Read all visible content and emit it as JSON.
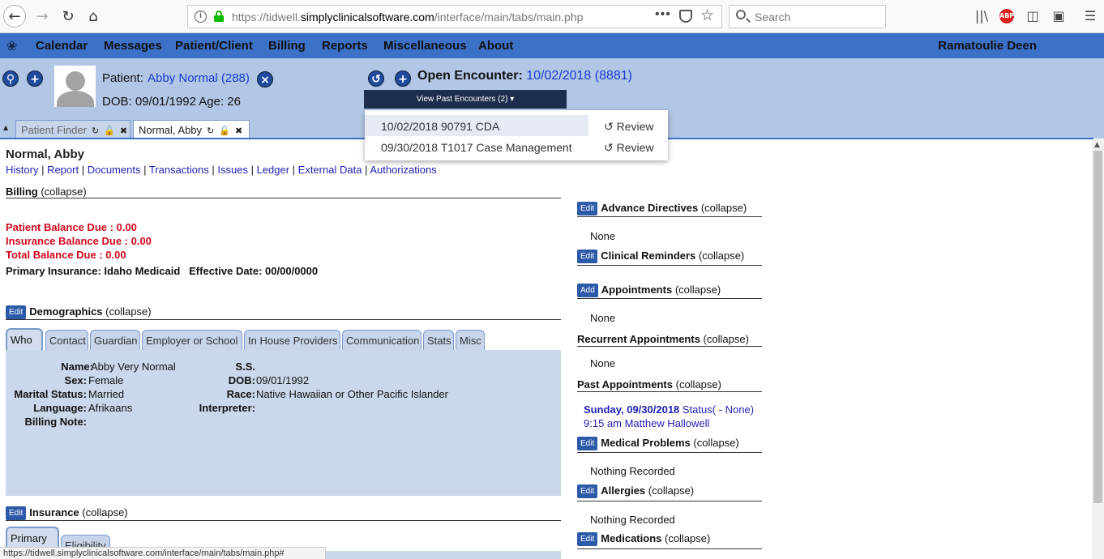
{
  "browser": {
    "url_prefix": "https://tidwell.",
    "url_domain": "simplyclinicalsoftware.com",
    "url_path": "/interface/main/tabs/main.php",
    "search_placeholder": "Search",
    "abp_label": "ABP"
  },
  "menu": {
    "items": [
      "Calendar",
      "Messages",
      "Patient/Client",
      "Billing",
      "Reports",
      "Miscellaneous",
      "About"
    ],
    "user": "Ramatoulie Deen"
  },
  "patient_header": {
    "patient_label": "Patient:",
    "patient_name": "Abby Normal (288)",
    "dob_line": "DOB: 09/01/1992 Age: 26",
    "encounter_label": "Open Encounter:",
    "encounter_value": "10/02/2018 (8881)",
    "past_encounters_button": "View Past Encounters  (2) ▾"
  },
  "tabs": [
    {
      "label": "Patient Finder",
      "active": false
    },
    {
      "label": "Normal, Abby",
      "active": true
    }
  ],
  "past_encounters": [
    {
      "label": "10/02/2018 90791 CDA",
      "action": "Review"
    },
    {
      "label": "09/30/2018 T1017 Case Management",
      "action": "Review"
    }
  ],
  "summary": {
    "name": "Normal, Abby",
    "links": [
      "History",
      "Report",
      "Documents",
      "Transactions",
      "Issues",
      "Ledger",
      "External Data",
      "Authorizations"
    ],
    "collapse": "(collapse)",
    "billing": {
      "title": "Billing",
      "patient_balance": "Patient Balance Due : 0.00",
      "insurance_balance": "Insurance Balance Due : 0.00",
      "total_balance": "Total Balance Due : 0.00",
      "primary_insurance": "Primary Insurance: Idaho Medicaid",
      "effective_date": "Effective Date: 00/00/0000"
    },
    "demographics": {
      "edit": "Edit",
      "title": "Demographics",
      "tabs": [
        "Who",
        "Contact",
        "Guardian",
        "Employer or School",
        "In House Providers",
        "Communication",
        "Stats",
        "Misc"
      ],
      "fields_left": [
        {
          "label": "Name:",
          "value": "Abby Very Normal"
        },
        {
          "label": "Sex:",
          "value": "Female"
        },
        {
          "label": "Marital Status:",
          "value": "Married"
        },
        {
          "label": "Language:",
          "value": "Afrikaans"
        },
        {
          "label": "Billing Note:",
          "value": ""
        }
      ],
      "fields_right": [
        {
          "label": "S.S.",
          "value": ""
        },
        {
          "label": "DOB:",
          "value": "09/01/1992"
        },
        {
          "label": "Race:",
          "value": "Native Hawaiian or Other Pacific Islander"
        },
        {
          "label": "Interpreter:",
          "value": ""
        }
      ]
    },
    "insurance": {
      "edit": "Edit",
      "title": "Insurance",
      "tabs": [
        "Primary",
        "Eligibility"
      ]
    }
  },
  "right_panels": {
    "advance_directives": {
      "btn": "Edit",
      "title": "Advance Directives",
      "body": "None"
    },
    "clinical_reminders": {
      "btn": "Edit",
      "title": "Clinical Reminders"
    },
    "appointments": {
      "btn": "Add",
      "title": "Appointments",
      "body": "None"
    },
    "recurrent_appointments": {
      "title": "Recurrent Appointments",
      "body": "None"
    },
    "past_appointments": {
      "title": "Past Appointments",
      "date": "Sunday, 09/30/2018",
      "status": " Status( - None)",
      "time_provider": "9:15 am Matthew Hallowell"
    },
    "medical_problems": {
      "btn": "Edit",
      "title": "Medical Problems",
      "body": "Nothing Recorded"
    },
    "allergies": {
      "btn": "Edit",
      "title": "Allergies",
      "body": "Nothing Recorded"
    },
    "medications": {
      "btn": "Edit",
      "title": "Medications"
    }
  },
  "status_bar_url": "https://tidwell.simplyclinicalsoftware.com/interface/main/tabs/main.php#",
  "colors": {
    "menu_bar": "#3c71c8",
    "header_bg": "#b2c7e6",
    "balance_red": "#d4061b",
    "link_blue": "#1f1fb3"
  }
}
